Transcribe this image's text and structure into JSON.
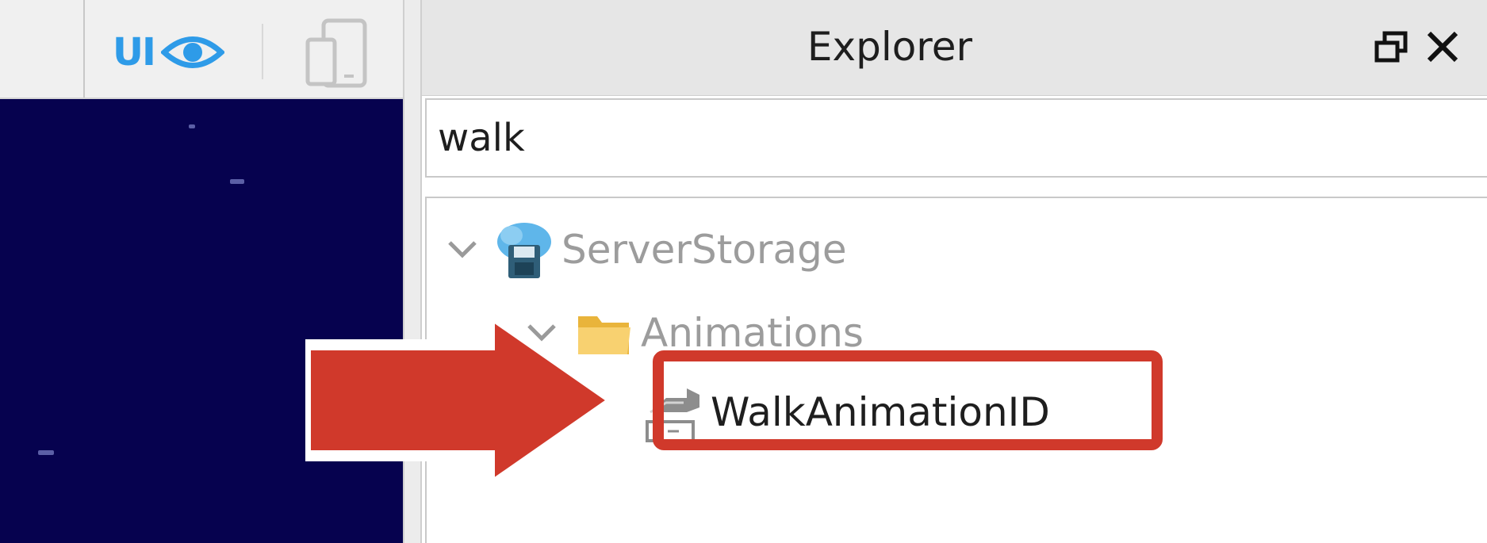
{
  "left_toolbar": {
    "ui_toggle_label": "UI",
    "ui_icon": "eye-icon",
    "device_icon": "device-emulator-icon",
    "accent_color": "#2e9be8"
  },
  "viewport": {
    "background_color": "#06024f"
  },
  "explorer": {
    "title": "Explorer",
    "restore_icon": "restore-window-icon",
    "close_icon": "close-icon",
    "search": {
      "value": "walk",
      "placeholder": ""
    },
    "tree": [
      {
        "label": "ServerStorage",
        "icon": "server-storage-icon",
        "expanded": true
      },
      {
        "label": "Animations",
        "icon": "folder-icon",
        "expanded": true
      },
      {
        "label": "WalkAnimationID",
        "icon": "string-value-icon",
        "highlighted": true
      }
    ]
  },
  "annotation": {
    "arrow_icon": "arrow-right-icon",
    "highlight_color": "#d0392b"
  }
}
